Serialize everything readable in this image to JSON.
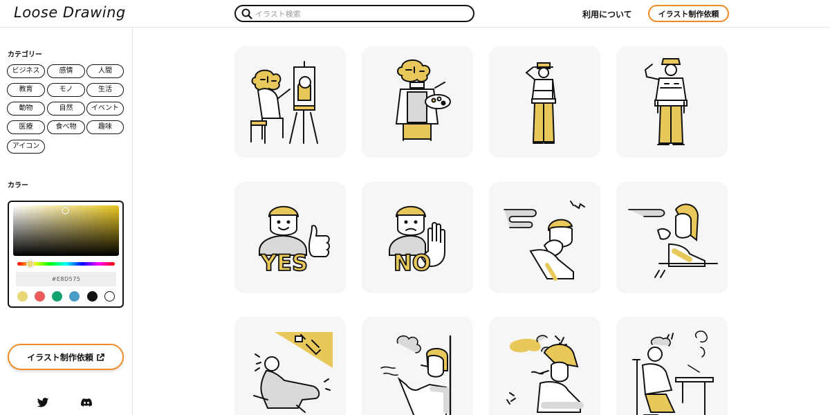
{
  "header": {
    "logo": "Loose Drawing",
    "search_placeholder": "イラスト検索",
    "about_link": "利用について",
    "request_button": "イラスト制作依頼"
  },
  "sidebar": {
    "category_title": "カテゴリー",
    "categories": [
      "ビジネス",
      "感情",
      "人間",
      "教育",
      "モノ",
      "生活",
      "動物",
      "自然",
      "イベント",
      "医療",
      "食べ物",
      "趣味",
      "アイコン"
    ],
    "color_title": "カラー",
    "color_picker": {
      "hex_value": "#E8D575",
      "swatches": [
        "#e8d575",
        "#ea5a5a",
        "#12a36e",
        "#4a9cc6",
        "#111111",
        "#ffffff"
      ]
    },
    "request_button": "イラスト制作依頼",
    "social": [
      "twitter-icon",
      "discord-icon"
    ]
  },
  "colors": {
    "accent_orange": "#f08a24",
    "illustration_yellow": "#e8c85a",
    "card_bg": "#f6f6f6"
  },
  "gallery": {
    "items": [
      {
        "subject": "brain-painter",
        "text": ""
      },
      {
        "subject": "brain-artist-palette",
        "text": ""
      },
      {
        "subject": "police-officer-salute",
        "text": ""
      },
      {
        "subject": "officer-salute",
        "text": ""
      },
      {
        "subject": "boy-thumbs-up",
        "text": "YES"
      },
      {
        "subject": "boy-stop-hand",
        "text": "NO"
      },
      {
        "subject": "boy-smoke-cough",
        "text": ""
      },
      {
        "subject": "woman-smoke-cough",
        "text": ""
      },
      {
        "subject": "man-fallen-syringe",
        "text": ""
      },
      {
        "subject": "man-smoking",
        "text": ""
      },
      {
        "subject": "woman-smoking",
        "text": ""
      },
      {
        "subject": "man-smoking-desk",
        "text": ""
      }
    ]
  }
}
